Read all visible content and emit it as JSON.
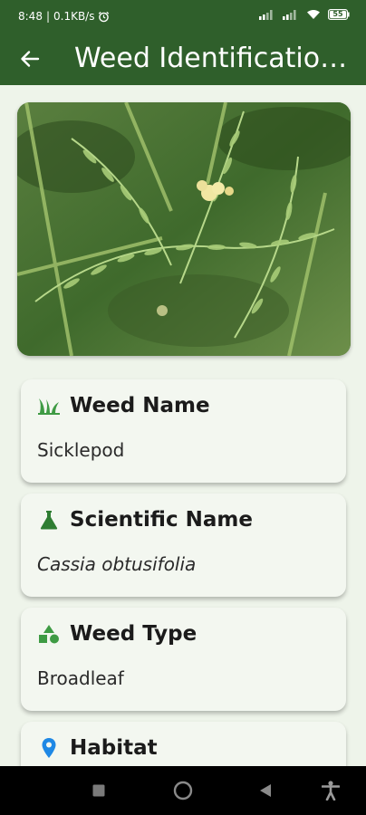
{
  "status_bar": {
    "time": "8:48",
    "network_speed": "0.1KB/s",
    "battery": "55",
    "icons": [
      "alarm-icon",
      "signal-icon",
      "wifi-icon",
      "battery-icon"
    ]
  },
  "app_bar": {
    "title": "Weed Identification...",
    "back_icon": "arrow-back-icon",
    "background_color": "#2f5f2b"
  },
  "photo": {
    "subject": "weed-photo"
  },
  "cards": [
    {
      "title": "Weed Name",
      "value": "Sicklepod",
      "icon": "grass-icon",
      "icon_color": "#3e9b44"
    },
    {
      "title": "Scientific Name",
      "value": "Cassia obtusifolia",
      "icon": "flask-icon",
      "icon_color": "#2e7d32"
    },
    {
      "title": "Weed Type",
      "value": "Broadleaf",
      "icon": "shapes-icon",
      "icon_color": "#3e9b44"
    },
    {
      "title": "Habitat",
      "value": "",
      "icon": "location-pin-icon",
      "icon_color": "#1e88e5"
    }
  ],
  "nav_bar": {
    "items": [
      "recents-button",
      "home-button",
      "back-button",
      "accessibility-button"
    ]
  }
}
